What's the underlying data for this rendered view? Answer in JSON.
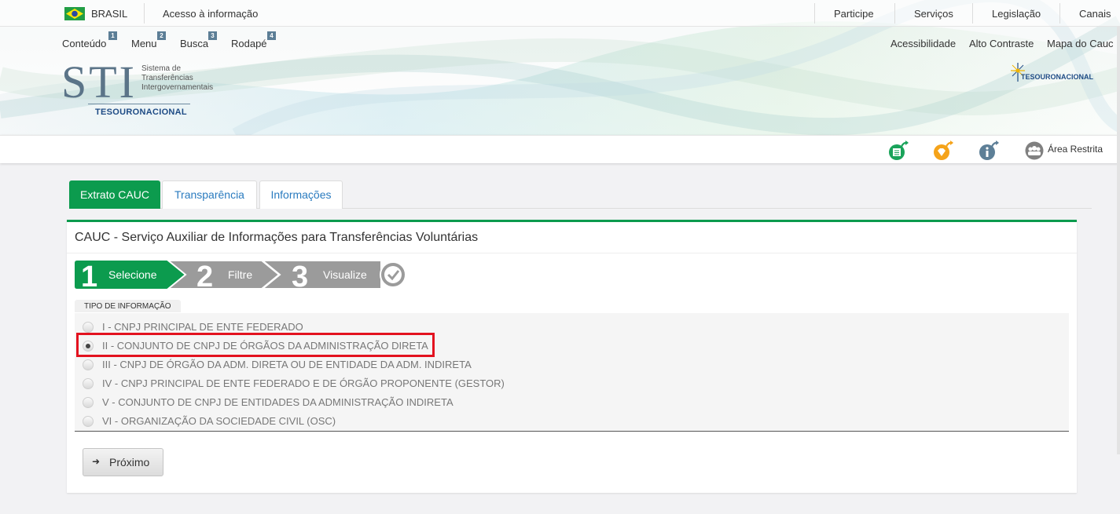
{
  "gov_bar": {
    "country": "BRASIL",
    "access_info": "Acesso à informação",
    "links": [
      "Participe",
      "Serviços",
      "Legislação",
      "Canais"
    ]
  },
  "shortcuts": [
    {
      "label": "Conteúdo",
      "num": "1"
    },
    {
      "label": "Menu",
      "num": "2"
    },
    {
      "label": "Busca",
      "num": "3"
    },
    {
      "label": "Rodapé",
      "num": "4"
    }
  ],
  "accessibility_links": [
    "Acessibilidade",
    "Alto Contraste",
    "Mapa do Cauc"
  ],
  "logo": {
    "acronym": "STI",
    "subtitle_lines": [
      "Sistema de",
      "Transferências",
      "Intergovernamentais"
    ],
    "agency": "TESOURONACIONAL"
  },
  "agency_logo_right": "TESOURONACIONAL",
  "toolbar": {
    "icons": [
      "document-icon",
      "diamond-icon",
      "info-icon",
      "users-icon"
    ],
    "area_restrita": "Área Restrita"
  },
  "tabs": [
    {
      "label": "Extrato CAUC",
      "active": true
    },
    {
      "label": "Transparência",
      "active": false
    },
    {
      "label": "Informações",
      "active": false
    }
  ],
  "panel": {
    "title": "CAUC - Serviço Auxiliar de Informações para Transferências Voluntárias",
    "steps": [
      {
        "num": "1",
        "label": "Selecione",
        "active": true
      },
      {
        "num": "2",
        "label": "Filtre",
        "active": false
      },
      {
        "num": "3",
        "label": "Visualize",
        "active": false
      }
    ],
    "group_label": "TIPO DE INFORMAÇÃO",
    "options": [
      {
        "label": "I - CNPJ PRINCIPAL DE ENTE FEDERADO",
        "checked": false
      },
      {
        "label": "II - CONJUNTO DE CNPJ DE ÓRGÃOS DA ADMINISTRAÇÃO DIRETA",
        "checked": true
      },
      {
        "label": "III - CNPJ DE ÓRGÃO DA ADM. DIRETA OU DE ENTIDADE DA ADM. INDIRETA",
        "checked": false
      },
      {
        "label": "IV - CNPJ PRINCIPAL DE ENTE FEDERADO E DE ÓRGÃO PROPONENTE (GESTOR)",
        "checked": false
      },
      {
        "label": "V - CONJUNTO DE CNPJ DE ENTIDADES DA ADMINISTRAÇÃO INDIRETA",
        "checked": false
      },
      {
        "label": "VI - ORGANIZAÇÃO DA SOCIEDADE CIVIL (OSC)",
        "checked": false
      }
    ],
    "next_button": "Próximo"
  },
  "colors": {
    "accent_green": "#0c9b4e",
    "step_gray": "#9b9b9b",
    "link_blue": "#2a7bbf",
    "highlight_red": "#e3121f"
  }
}
